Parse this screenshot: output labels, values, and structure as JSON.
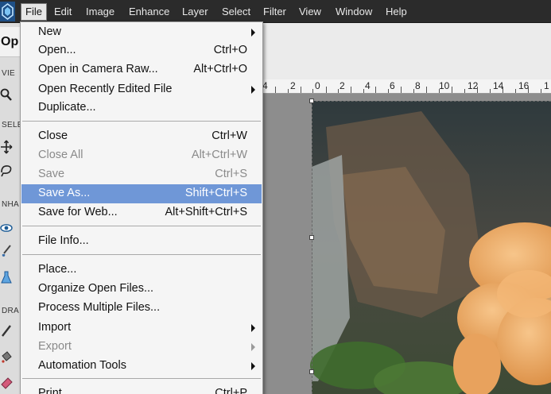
{
  "app": {
    "title_fragment": "Op",
    "logo_icon": "elements-logo-icon",
    "accent": "#1f6fb5"
  },
  "menubar": {
    "items": [
      {
        "label": "File",
        "active": true
      },
      {
        "label": "Edit"
      },
      {
        "label": "Image"
      },
      {
        "label": "Enhance"
      },
      {
        "label": "Layer"
      },
      {
        "label": "Select"
      },
      {
        "label": "Filter"
      },
      {
        "label": "View"
      },
      {
        "label": "Window"
      },
      {
        "label": "Help"
      }
    ]
  },
  "left_panel": {
    "sections": [
      "VIE",
      "SELE",
      "NHA",
      "DRA"
    ],
    "tools": [
      "zoom-icon",
      "move-icon",
      "lasso-icon",
      "eye-icon",
      "brush-icon",
      "sponge-icon",
      "pencil-icon",
      "paint-bucket-icon",
      "eraser-icon"
    ]
  },
  "ruler": {
    "labels": [
      "4",
      "2",
      "0",
      "2",
      "4",
      "6",
      "8",
      "10",
      "12",
      "14",
      "16",
      "1"
    ]
  },
  "file_menu": {
    "highlight_color": "#6f97d7",
    "items": [
      {
        "label": "New",
        "shortcut": "",
        "submenu": true,
        "disabled": false
      },
      {
        "label": "Open...",
        "shortcut": "Ctrl+O",
        "submenu": false,
        "disabled": false
      },
      {
        "label": "Open in Camera Raw...",
        "shortcut": "Alt+Ctrl+O",
        "submenu": false,
        "disabled": false
      },
      {
        "label": "Open Recently Edited File",
        "shortcut": "",
        "submenu": true,
        "disabled": false
      },
      {
        "label": "Duplicate...",
        "shortcut": "",
        "submenu": false,
        "disabled": false
      },
      {
        "label": "Close",
        "shortcut": "Ctrl+W",
        "submenu": false,
        "disabled": false
      },
      {
        "label": "Close All",
        "shortcut": "Alt+Ctrl+W",
        "submenu": false,
        "disabled": true
      },
      {
        "label": "Save",
        "shortcut": "Ctrl+S",
        "submenu": false,
        "disabled": true
      },
      {
        "label": "Save As...",
        "shortcut": "Shift+Ctrl+S",
        "submenu": false,
        "disabled": false,
        "highlighted": true
      },
      {
        "label": "Save for Web...",
        "shortcut": "Alt+Shift+Ctrl+S",
        "submenu": false,
        "disabled": false
      },
      {
        "label": "File Info...",
        "shortcut": "",
        "submenu": false,
        "disabled": false
      },
      {
        "label": "Place...",
        "shortcut": "",
        "submenu": false,
        "disabled": false
      },
      {
        "label": "Organize Open Files...",
        "shortcut": "",
        "submenu": false,
        "disabled": false
      },
      {
        "label": "Process Multiple Files...",
        "shortcut": "",
        "submenu": false,
        "disabled": false
      },
      {
        "label": "Import",
        "shortcut": "",
        "submenu": true,
        "disabled": false
      },
      {
        "label": "Export",
        "shortcut": "",
        "submenu": true,
        "disabled": true
      },
      {
        "label": "Automation Tools",
        "shortcut": "",
        "submenu": true,
        "disabled": false
      },
      {
        "label": "Print...",
        "shortcut": "Ctrl+P",
        "submenu": false,
        "disabled": false
      }
    ]
  }
}
